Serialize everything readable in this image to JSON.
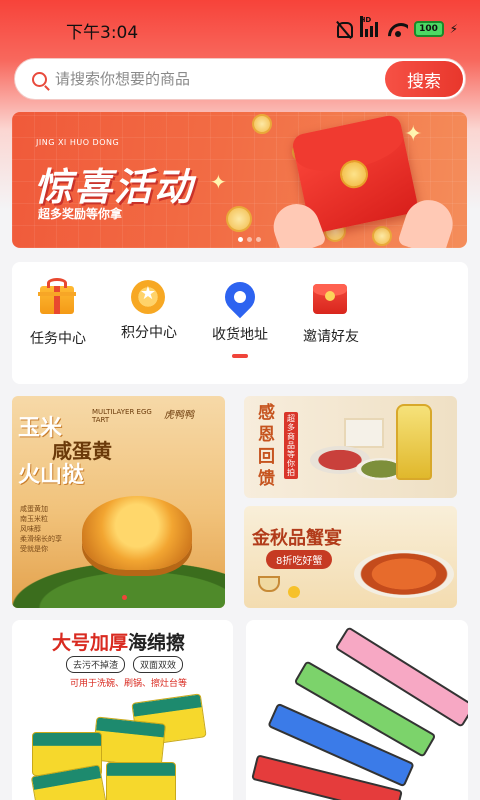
{
  "status_bar": {
    "time": "下午3:04",
    "network_label": "HD",
    "battery_level": "100"
  },
  "search": {
    "placeholder": "请搜索你想要的商品",
    "button_label": "搜索"
  },
  "banner": {
    "pinyin": "JING XI HUO DONG",
    "title": "惊喜活动",
    "subtitle": "超多奖励等你拿"
  },
  "quick_nav": {
    "items": [
      {
        "label": "任务中心",
        "icon": "gift-icon"
      },
      {
        "label": "积分中心",
        "icon": "points-icon"
      },
      {
        "label": "收货地址",
        "icon": "location-pin-icon"
      },
      {
        "label": "邀请好友",
        "icon": "red-packet-icon"
      }
    ]
  },
  "promo_left": {
    "title_line1": "玉米",
    "title_line2": "咸蛋黄",
    "title_line3": "火山挞",
    "english": "MULTILAYER EGG TART",
    "brand": "虎鸭鸭",
    "small_text": "咸蛋黄加\n南玉米粒\n风味醇\n柔滑绵长的享\n受就是你"
  },
  "promo_right_top": {
    "title": "感恩回馈",
    "tag": "超多商品等你拍"
  },
  "promo_right_bottom": {
    "title": "金秋品蟹宴",
    "pill": "8折吃好蟹"
  },
  "product_left": {
    "title_highlight": "大号加厚",
    "title_rest": "海绵擦",
    "tags": [
      "去污不掉渣",
      "双面双效"
    ],
    "subtitle": "可用于洗碗、刷锅、擦灶台等"
  },
  "colors": {
    "accent": "#f0443a",
    "header_red": "#f7433a",
    "pin_blue": "#2d63f0"
  }
}
